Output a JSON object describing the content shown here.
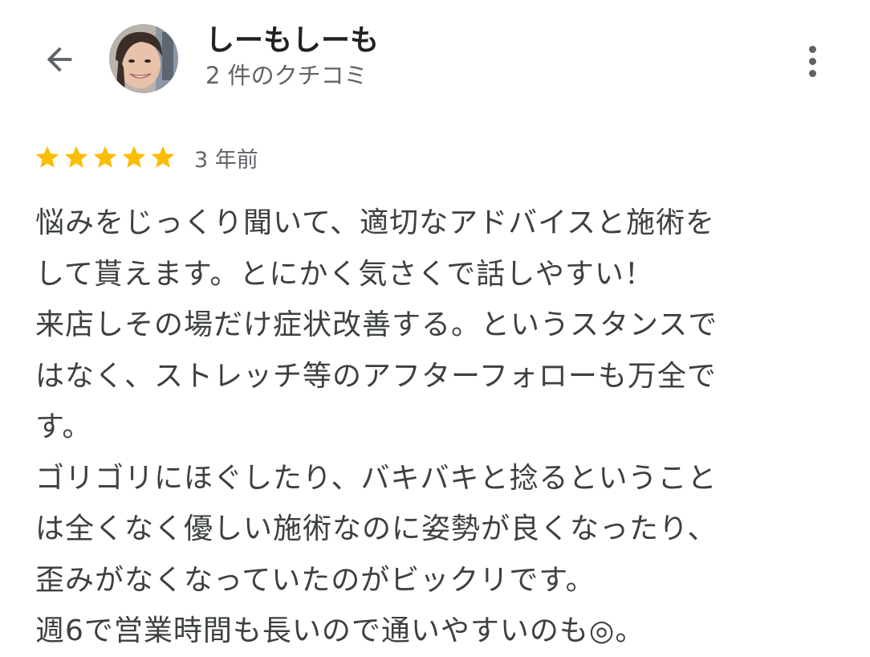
{
  "header": {
    "user_name": "しーもしーも",
    "review_count": "2 件のクチコミ"
  },
  "review": {
    "rating": 5,
    "rating_max": 5,
    "star_color": "#fbbc04",
    "date": "3 年前",
    "lines": [
      "悩みをじっくり聞いて、適切なアドバイスと施術を",
      "して貰えます。とにかく気さくで話しやすい！",
      "来店しその場だけ症状改善する。というスタンスで",
      "はなく、ストレッチ等のアフターフォローも万全で",
      "す。",
      "ゴリゴリにほぐしたり、バキバキと捻るということ",
      "は全くなく優しい施術なのに姿勢が良くなったり、",
      "歪みがなくなっていたのがビックリです。",
      "週6で営業時間も長いので通いやすいのも◎。"
    ]
  },
  "icons": {
    "back": "arrow-back-icon",
    "more": "more-vert-icon",
    "star": "star-icon"
  }
}
